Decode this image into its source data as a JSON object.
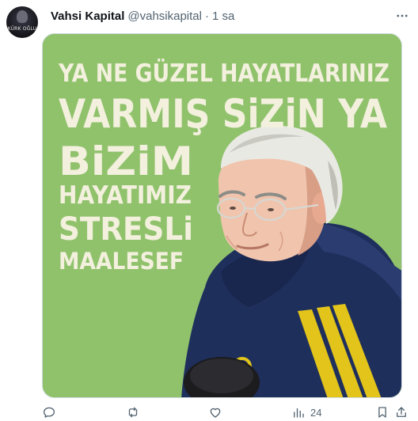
{
  "tweet": {
    "display_name": "Vahsi Kapital",
    "handle": "@vahsikapital",
    "separator": "·",
    "time": "1 sa",
    "avatar_text": "KÜRK OĞLU"
  },
  "media": {
    "lines": [
      "YA NE GÜZEL HAYATLARINIZ",
      "VARMIŞ SiZiN YA",
      "BiZiM",
      "HAYATIMIZ",
      "STRESLi",
      "MAALESEF"
    ],
    "background_color": "#8cbf68",
    "text_color": "#f3f0de",
    "jacket_color": "#1f2f5c",
    "stripe_color": "#e2c41a"
  },
  "actions": {
    "views_count": "24"
  },
  "icons": {
    "more": "more-horizontal-icon",
    "reply": "reply-icon",
    "retweet": "retweet-icon",
    "like": "heart-icon",
    "views": "views-chart-icon",
    "bookmark": "bookmark-icon",
    "share": "share-icon"
  }
}
